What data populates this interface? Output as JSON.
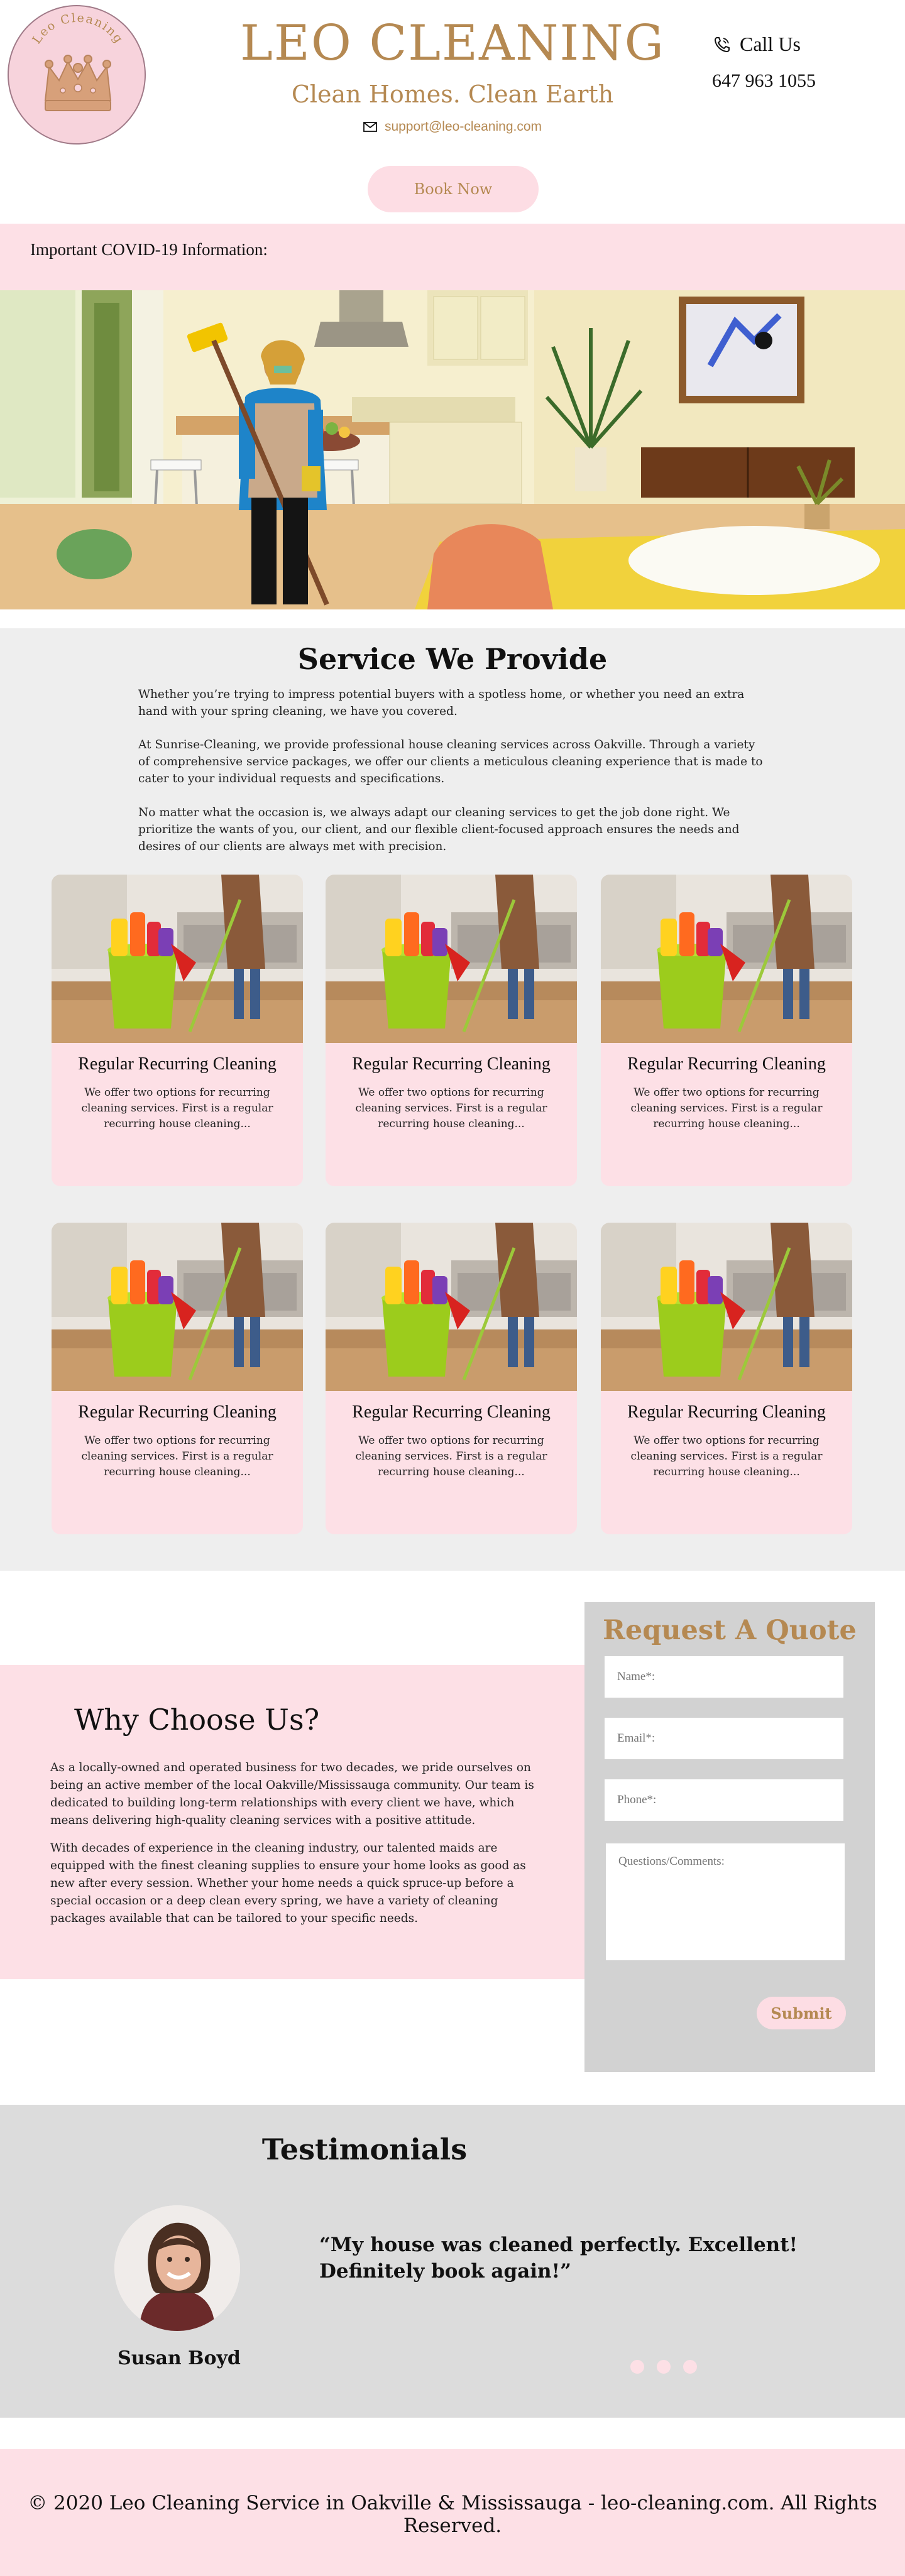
{
  "header": {
    "logo_text": "Leo Cleaning",
    "brand": "LEO CLEANING",
    "tagline": "Clean Homes. Clean Earth",
    "email": "support@leo-cleaning.com",
    "call_label": "Call Us",
    "phone": "647 963 1055",
    "book_label": "Book Now",
    "accent_color": "#b58952",
    "pink": "#fde0e6"
  },
  "covid": {
    "text": "Important COVID-19 Information:"
  },
  "services": {
    "title": "Service We Provide",
    "paragraphs": [
      "Whether you’re trying to impress potential buyers with a spotless home, or whether you need an extra hand with your spring cleaning, we have you covered.",
      "At Sunrise-Cleaning, we provide professional house cleaning services across Oakville. Through a variety of comprehensive service packages, we offer our clients a meticulous cleaning experience that is made to cater to your individual requests and specifications.",
      "No matter what the occasion is, we always adapt our cleaning services to get the job done right. We prioritize the wants of you, our client, and our flexible client-focused approach ensures the needs and desires of our clients are always met with precision."
    ],
    "cards": [
      {
        "title": "Regular Recurring Cleaning",
        "desc": "We offer two options for recurring cleaning services. First is a regular recurring house cleaning..."
      },
      {
        "title": "Regular Recurring Cleaning",
        "desc": "We offer two options for recurring cleaning services. First is a regular recurring house cleaning..."
      },
      {
        "title": "Regular Recurring Cleaning",
        "desc": "We offer two options for recurring cleaning services. First is a regular recurring house cleaning..."
      },
      {
        "title": "Regular Recurring Cleaning",
        "desc": "We offer two options for recurring cleaning services. First is a regular recurring house cleaning..."
      },
      {
        "title": "Regular Recurring Cleaning",
        "desc": "We offer two options for recurring cleaning services. First is a regular recurring house cleaning..."
      },
      {
        "title": "Regular Recurring Cleaning",
        "desc": "We offer two options for recurring cleaning services. First is a regular recurring house cleaning..."
      }
    ]
  },
  "why": {
    "title": "Why Choose Us?",
    "paragraphs": [
      "As a locally-owned and operated business for two decades, we pride ourselves on being an active member of the local Oakville/Mississauga community. Our team is dedicated to building long-term relationships with every client we have, which means delivering high-quality cleaning services with a positive attitude.",
      "With decades of experience in the cleaning industry, our talented maids are equipped with the finest cleaning supplies to ensure your home looks as good as new after every session. Whether your home needs a quick spruce-up before a special occasion or a deep clean every spring, we have a variety of cleaning packages available that can be tailored to your specific needs."
    ]
  },
  "quote": {
    "title": "Request A Quote",
    "name_placeholder": "Name*:",
    "email_placeholder": "Email*:",
    "phone_placeholder": "Phone*:",
    "comments_placeholder": "Questions/Comments:",
    "submit_label": "Submit"
  },
  "testimonials": {
    "title": "Testimonials",
    "quote": "“My house was cleaned perfectly. Excellent! Definitely book again!”",
    "name": "Susan Boyd"
  },
  "footer": {
    "text": "© 2020 Leo Cleaning Service in Oakville & Mississauga - leo-cleaning.com. All Rights Reserved."
  }
}
